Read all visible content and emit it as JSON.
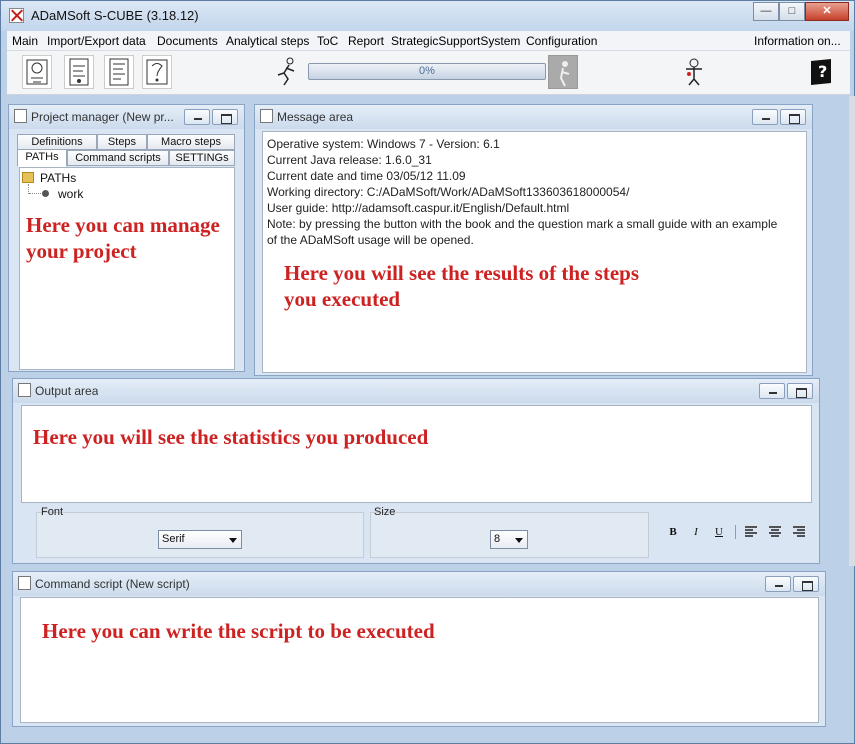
{
  "window": {
    "title": "ADaMSoft S-CUBE (3.18.12)"
  },
  "menu": {
    "items": [
      "Main",
      "Import/Export data",
      "Documents",
      "Analytical steps",
      "ToC",
      "Report",
      "StrategicSupportSystem",
      "Configuration"
    ],
    "right_item": "Information on..."
  },
  "toolbar": {
    "icons": [
      "paths-icon",
      "data-icon",
      "script-icon",
      "guide-icon"
    ],
    "progress_text": "0%",
    "progress_value": 0
  },
  "project_manager": {
    "title": "Project manager (New pr...",
    "tabs_row1": [
      "Definitions",
      "Steps",
      "Macro steps"
    ],
    "tabs_row2": [
      "PATHs",
      "Command scripts",
      "SETTINGs"
    ],
    "active_tab": "PATHs",
    "tree_root": "PATHs",
    "tree_child": "work",
    "annotation": "Here you can manage your project"
  },
  "message_area": {
    "title": "Message area",
    "lines": [
      "Operative system: Windows 7 - Version: 6.1",
      "Current Java release: 1.6.0_31",
      "Current date and time 03/05/12 11.09",
      "Working directory: C:/ADaMSoft/Work/ADaMSoft133603618000054/",
      "User guide: http://adamsoft.caspur.it/English/Default.html",
      "Note: by pressing the button with the book and the question mark a small guide with an example",
      "of the ADaMSoft usage will be opened."
    ],
    "annotation_line1": "Here you will see the results of the steps",
    "annotation_line2": "you executed"
  },
  "output_area": {
    "title": "Output area",
    "annotation": "Here you will see the statistics you produced",
    "font_label": "Font",
    "font_value": "Serif",
    "size_label": "Size",
    "size_value": "8",
    "format_buttons": [
      "B",
      "I",
      "U"
    ]
  },
  "command_script": {
    "title": "Command script (New script)",
    "annotation": "Here you can write the script to be executed"
  }
}
